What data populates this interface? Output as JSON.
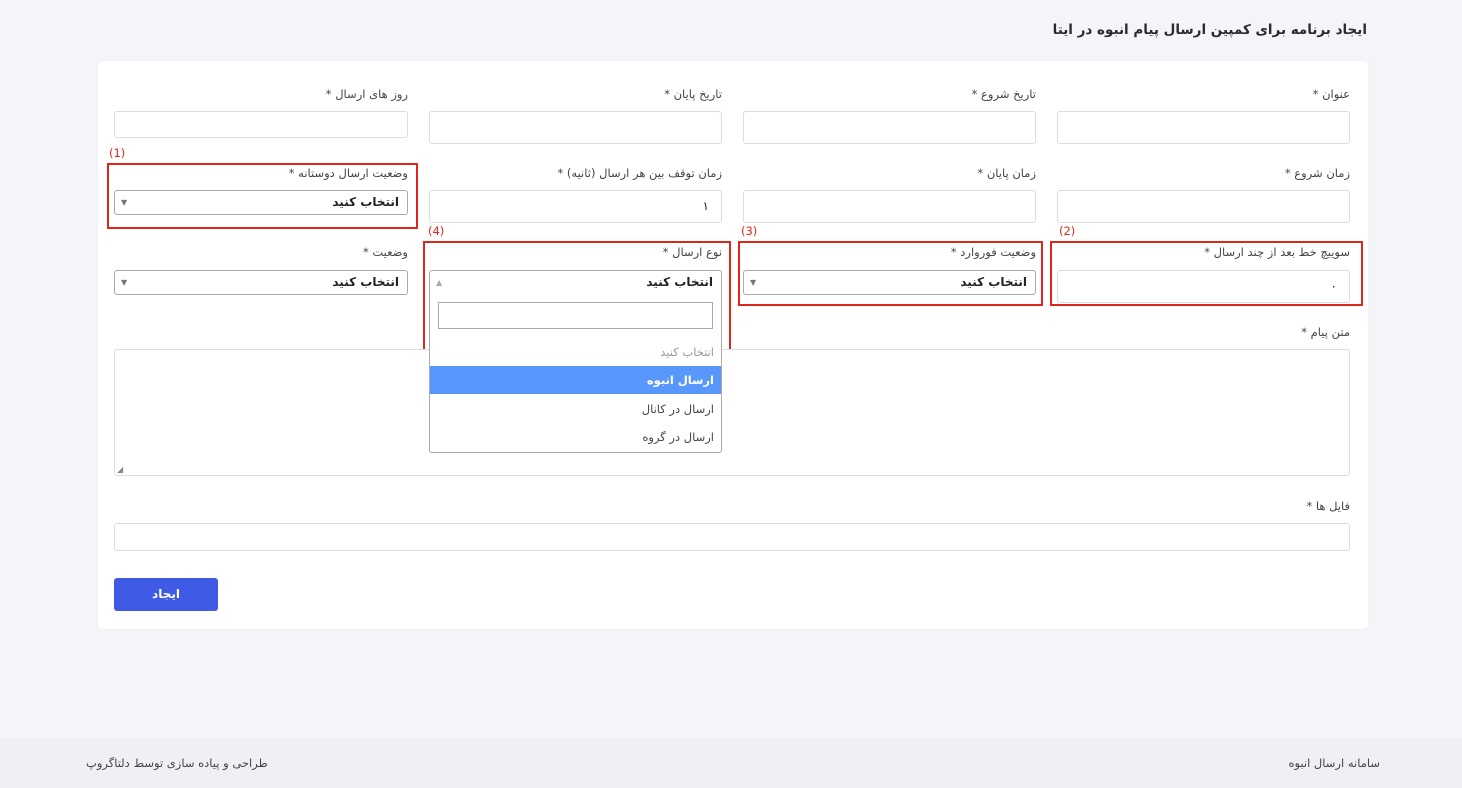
{
  "page": {
    "title": "ایجاد برنامه برای کمپین ارسال پیام انبوه در ایتا"
  },
  "form": {
    "title_label": "عنوان *",
    "start_date_label": "تاریخ شروع *",
    "end_date_label": "تاریخ پایان *",
    "send_days_label": "روز های ارسال *",
    "start_time_label": "زمان شروع *",
    "end_time_label": "زمان پایان *",
    "pause_label": "زمان توقف بین هر ارسال (ثانیه) *",
    "pause_value": "۱",
    "friend_status_label": "وضعیت ارسال دوستانه *",
    "friend_status_value": "انتخاب کنید",
    "line_switch_label": "سوییچ خط بعد از چند ارسال *",
    "line_switch_value": "۰",
    "forward_status_label": "وضعیت فوروارد *",
    "forward_status_value": "انتخاب کنید",
    "send_type_label": "نوع ارسال *",
    "send_type_value": "انتخاب کنید",
    "status_label": "وضعیت *",
    "status_value": "انتخاب کنید",
    "message_label": "متن پیام *",
    "files_label": "فایل ها *",
    "submit_label": "ایجاد"
  },
  "send_type_dropdown": {
    "options": [
      "انتخاب کنید",
      "ارسال انبوه",
      "ارسال در کانال",
      "ارسال در گروه"
    ],
    "highlighted": "ارسال انبوه"
  },
  "annotations": {
    "n1": "(1)",
    "n2": "(2)",
    "n3": "(3)",
    "n4": "(4)",
    "color": "#e0251b"
  },
  "footer": {
    "system_name": "سامانه ارسال انبوه",
    "credit": "طراحی و پیاده سازی توسط دلتاگروپ"
  },
  "colors": {
    "primary_button": "#3f5be6",
    "dropdown_highlight": "#5897fb"
  }
}
